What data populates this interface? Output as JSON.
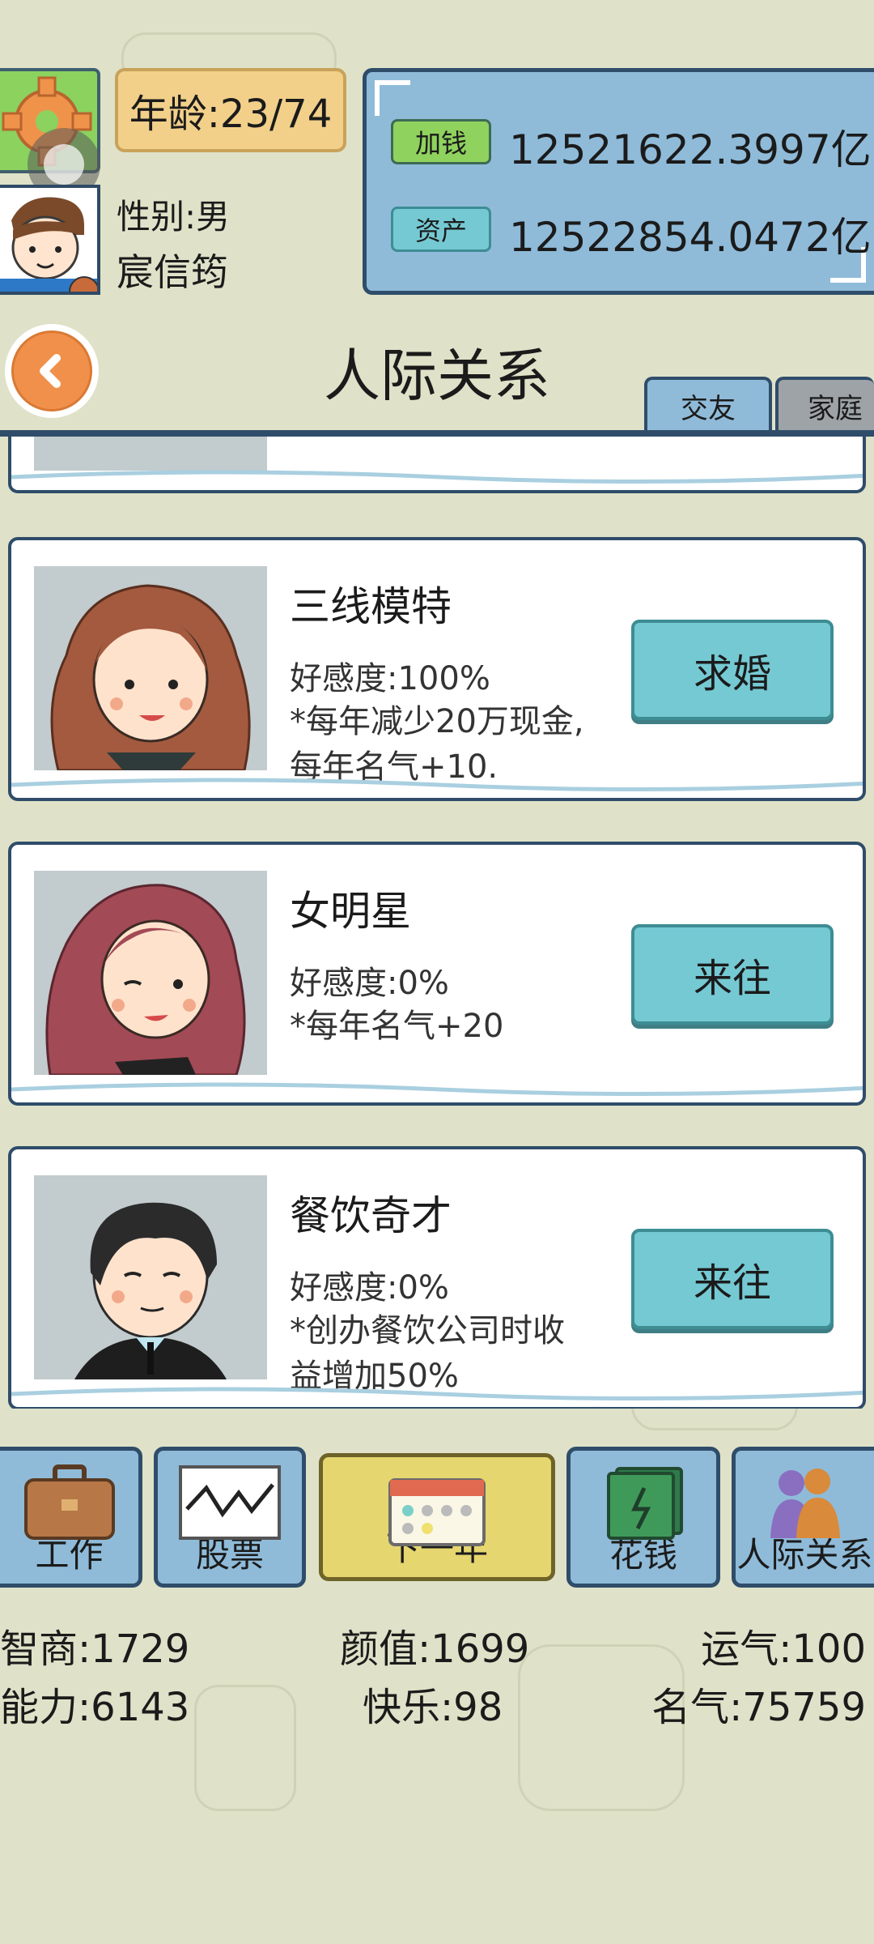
{
  "header": {
    "age_label": "年龄:23/74",
    "gender_label": "性别:男",
    "player_name": "宸信筠"
  },
  "money": {
    "add_money_label": "加钱",
    "add_money_value": "12521622.3997亿",
    "assets_label": "资产",
    "assets_value": "12522854.0472亿"
  },
  "page": {
    "title": "人际关系",
    "tabs": [
      {
        "label": "交友",
        "active": true
      },
      {
        "label": "家庭",
        "active": false
      }
    ]
  },
  "relations": [
    {
      "name": "三线模特",
      "favor": "好感度:100%",
      "desc_line1": "*每年减少20万现金,",
      "desc_line2": "每年名气+10.",
      "action": "求婚"
    },
    {
      "name": "女明星",
      "favor": "好感度:0%",
      "desc_line1": "*每年名气+20",
      "desc_line2": "",
      "action": "来往"
    },
    {
      "name": "餐饮奇才",
      "favor": "好感度:0%",
      "desc_line1": "*创办餐饮公司时收",
      "desc_line2": "益增加50%",
      "action": "来往"
    }
  ],
  "nav": [
    {
      "label": "工作",
      "icon": "briefcase-icon"
    },
    {
      "label": "股票",
      "icon": "stock-chart-icon"
    },
    {
      "label": "下一年",
      "icon": "calendar-icon"
    },
    {
      "label": "花钱",
      "icon": "cash-icon"
    },
    {
      "label": "人际关系",
      "icon": "people-icon"
    }
  ],
  "stats": {
    "iq": "智商:1729",
    "looks": "颜值:1699",
    "luck": "运气:100",
    "ability": "能力:6143",
    "happiness": "快乐:98",
    "fame": "名气:75759"
  },
  "colors": {
    "background": "#dfe2c8",
    "panel_blue": "#8fbbd9",
    "border_navy": "#2f4d6a",
    "action_teal": "#75c9d3",
    "next_year_yellow": "#e5d66f",
    "age_gold": "#f2d08a",
    "settings_green": "#8bd25f",
    "back_orange": "#f0904a"
  }
}
